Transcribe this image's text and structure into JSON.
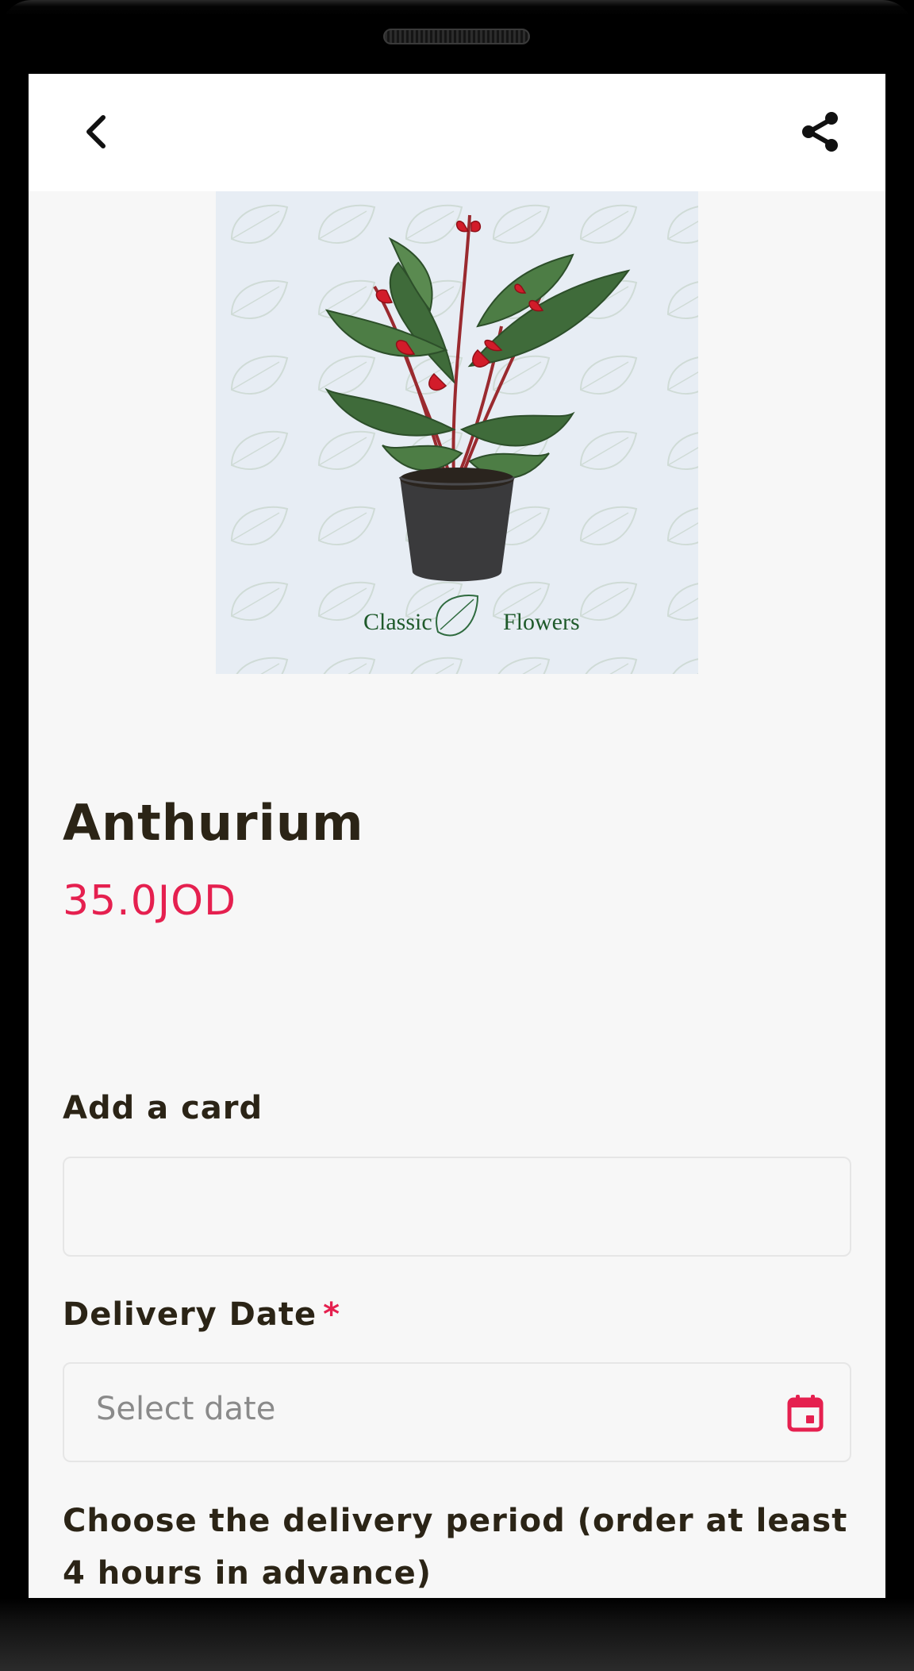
{
  "appbar": {
    "back_icon": "chevron-left-icon",
    "share_icon": "share-icon"
  },
  "product": {
    "image_caption_left": "Classic",
    "image_caption_right": "Flowers",
    "logo_text": "Classic Flowers",
    "name": "Anthurium",
    "price": "35.0JOD"
  },
  "form": {
    "card_label": "Add a card",
    "card_value": "",
    "delivery_date_label": "Delivery Date",
    "required_marker": "*",
    "date_placeholder": "Select date",
    "calendar_icon": "calendar-icon",
    "period_label": "Choose the delivery period (order at least 4 hours in advance)"
  },
  "colors": {
    "accent": "#e5204f",
    "text": "#2b2416",
    "background": "#f7f7f7"
  }
}
